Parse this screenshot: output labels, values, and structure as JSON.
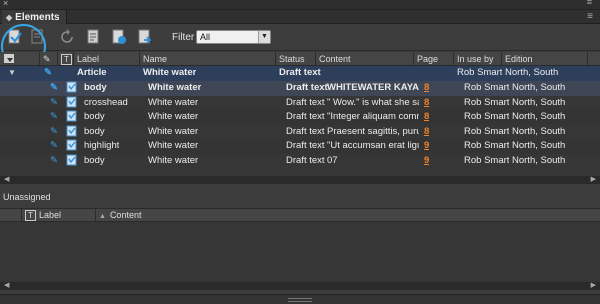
{
  "panel": {
    "tab_title": "Elements",
    "filter_label": "Filter :",
    "filter_value": "All"
  },
  "columns": {
    "label": "Label",
    "name": "Name",
    "status": "Status",
    "content": "Content",
    "page": "Page",
    "in_use_by": "In use by",
    "edition": "Edition"
  },
  "article": {
    "label": "Article",
    "name": "White water",
    "status": "Draft text",
    "in_use_by": "Rob Smart",
    "edition": "North, South"
  },
  "rows": [
    {
      "label": "body",
      "name": "White water",
      "status": "Draft text",
      "content": "WHITEWATER KAYAKING",
      "page": "8",
      "in_use_by": "Rob Smart",
      "edition": "North, South"
    },
    {
      "label": "crosshead",
      "name": "White water",
      "status": "Draft text",
      "content": "\" Wow.\" is what she said...",
      "page": "8",
      "in_use_by": "Rob Smart",
      "edition": "North, South"
    },
    {
      "label": "body",
      "name": "White water",
      "status": "Draft text",
      "content": "\"Integer aliquam comm...",
      "page": "8",
      "in_use_by": "Rob Smart",
      "edition": "North, South"
    },
    {
      "label": "body",
      "name": "White water",
      "status": "Draft text",
      "content": "Praesent sagittis, purus...",
      "page": "8",
      "in_use_by": "Rob Smart",
      "edition": "North, South"
    },
    {
      "label": "highlight",
      "name": "White water",
      "status": "Draft text",
      "content": "\"Ut accumsan erat ligul...",
      "page": "9",
      "in_use_by": "Rob Smart",
      "edition": "North, South"
    },
    {
      "label": "body",
      "name": "White water",
      "status": "Draft text",
      "content": "07",
      "page": "9",
      "in_use_by": "Rob Smart",
      "edition": "North, South"
    }
  ],
  "unassigned": {
    "title": "Unassigned",
    "col_label": "Label",
    "col_content": "Content"
  }
}
